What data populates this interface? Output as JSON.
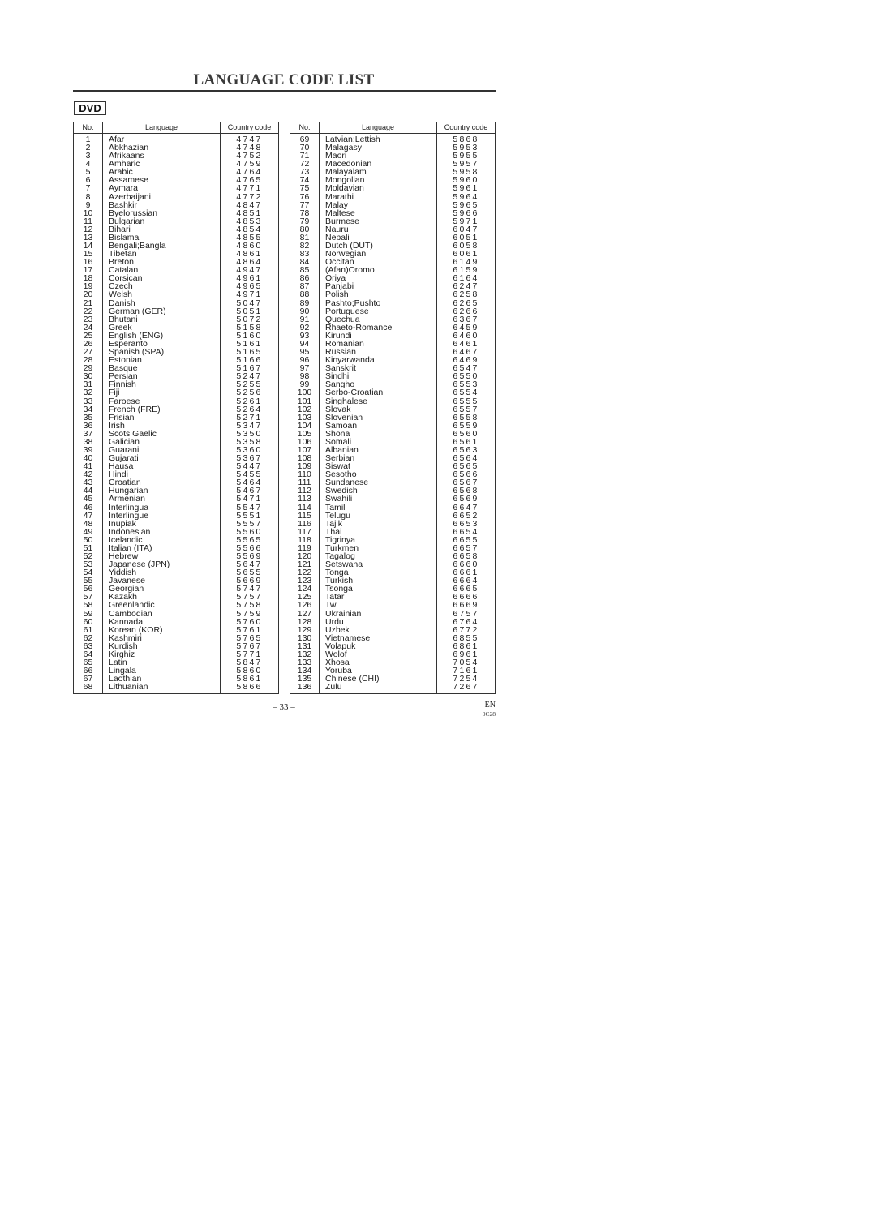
{
  "title": "LANGUAGE CODE LIST",
  "badge": "DVD",
  "columns": {
    "no": "No.",
    "language": "Language",
    "code": "Country code"
  },
  "tables": [
    {
      "rows": [
        [
          "1",
          "Afar",
          "4747"
        ],
        [
          "2",
          "Abkhazian",
          "4748"
        ],
        [
          "3",
          "Afrikaans",
          "4752"
        ],
        [
          "4",
          "Amharic",
          "4759"
        ],
        [
          "5",
          "Arabic",
          "4764"
        ],
        [
          "6",
          "Assamese",
          "4765"
        ],
        [
          "7",
          "Aymara",
          "4771"
        ],
        [
          "8",
          "Azerbaijani",
          "4772"
        ],
        [
          "9",
          "Bashkir",
          "4847"
        ],
        [
          "10",
          "Byelorussian",
          "4851"
        ],
        [
          "11",
          "Bulgarian",
          "4853"
        ],
        [
          "12",
          "Bihari",
          "4854"
        ],
        [
          "13",
          "Bislama",
          "4855"
        ],
        [
          "14",
          "Bengali;Bangla",
          "4860"
        ],
        [
          "15",
          "Tibetan",
          "4861"
        ],
        [
          "16",
          "Breton",
          "4864"
        ],
        [
          "17",
          "Catalan",
          "4947"
        ],
        [
          "18",
          "Corsican",
          "4961"
        ],
        [
          "19",
          "Czech",
          "4965"
        ],
        [
          "20",
          "Welsh",
          "4971"
        ],
        [
          "21",
          "Danish",
          "5047"
        ],
        [
          "22",
          "German (GER)",
          "5051"
        ],
        [
          "23",
          "Bhutani",
          "5072"
        ],
        [
          "24",
          "Greek",
          "5158"
        ],
        [
          "25",
          "English (ENG)",
          "5160"
        ],
        [
          "26",
          "Esperanto",
          "5161"
        ],
        [
          "27",
          "Spanish (SPA)",
          "5165"
        ],
        [
          "28",
          "Estonian",
          "5166"
        ],
        [
          "29",
          "Basque",
          "5167"
        ],
        [
          "30",
          "Persian",
          "5247"
        ],
        [
          "31",
          "Finnish",
          "5255"
        ],
        [
          "32",
          "Fiji",
          "5256"
        ],
        [
          "33",
          "Faroese",
          "5261"
        ],
        [
          "34",
          "French (FRE)",
          "5264"
        ],
        [
          "35",
          "Frisian",
          "5271"
        ],
        [
          "36",
          "Irish",
          "5347"
        ],
        [
          "37",
          "Scots Gaelic",
          "5350"
        ],
        [
          "38",
          "Galician",
          "5358"
        ],
        [
          "39",
          "Guarani",
          "5360"
        ],
        [
          "40",
          "Gujarati",
          "5367"
        ],
        [
          "41",
          "Hausa",
          "5447"
        ],
        [
          "42",
          "Hindi",
          "5455"
        ],
        [
          "43",
          "Croatian",
          "5464"
        ],
        [
          "44",
          "Hungarian",
          "5467"
        ],
        [
          "45",
          "Armenian",
          "5471"
        ],
        [
          "46",
          "Interlingua",
          "5547"
        ],
        [
          "47",
          "Interlingue",
          "5551"
        ],
        [
          "48",
          "Inupiak",
          "5557"
        ],
        [
          "49",
          "Indonesian",
          "5560"
        ],
        [
          "50",
          "Icelandic",
          "5565"
        ],
        [
          "51",
          "Italian (ITA)",
          "5566"
        ],
        [
          "52",
          "Hebrew",
          "5569"
        ],
        [
          "53",
          "Japanese (JPN)",
          "5647"
        ],
        [
          "54",
          "Yiddish",
          "5655"
        ],
        [
          "55",
          "Javanese",
          "5669"
        ],
        [
          "56",
          "Georgian",
          "5747"
        ],
        [
          "57",
          "Kazakh",
          "5757"
        ],
        [
          "58",
          "Greenlandic",
          "5758"
        ],
        [
          "59",
          "Cambodian",
          "5759"
        ],
        [
          "60",
          "Kannada",
          "5760"
        ],
        [
          "61",
          "Korean (KOR)",
          "5761"
        ],
        [
          "62",
          "Kashmiri",
          "5765"
        ],
        [
          "63",
          "Kurdish",
          "5767"
        ],
        [
          "64",
          "Kirghiz",
          "5771"
        ],
        [
          "65",
          "Latin",
          "5847"
        ],
        [
          "66",
          "Lingala",
          "5860"
        ],
        [
          "67",
          "Laothian",
          "5861"
        ],
        [
          "68",
          "Lithuanian",
          "5866"
        ]
      ]
    },
    {
      "rows": [
        [
          "69",
          "Latvian;Lettish",
          "5868"
        ],
        [
          "70",
          "Malagasy",
          "5953"
        ],
        [
          "71",
          "Maori",
          "5955"
        ],
        [
          "72",
          "Macedonian",
          "5957"
        ],
        [
          "73",
          "Malayalam",
          "5958"
        ],
        [
          "74",
          "Mongolian",
          "5960"
        ],
        [
          "75",
          "Moldavian",
          "5961"
        ],
        [
          "76",
          "Marathi",
          "5964"
        ],
        [
          "77",
          "Malay",
          "5965"
        ],
        [
          "78",
          "Maltese",
          "5966"
        ],
        [
          "79",
          "Burmese",
          "5971"
        ],
        [
          "80",
          "Nauru",
          "6047"
        ],
        [
          "81",
          "Nepali",
          "6051"
        ],
        [
          "82",
          "Dutch (DUT)",
          "6058"
        ],
        [
          "83",
          "Norwegian",
          "6061"
        ],
        [
          "84",
          "Occitan",
          "6149"
        ],
        [
          "85",
          "(Afan)Oromo",
          "6159"
        ],
        [
          "86",
          "Oriya",
          "6164"
        ],
        [
          "87",
          "Panjabi",
          "6247"
        ],
        [
          "88",
          "Polish",
          "6258"
        ],
        [
          "89",
          "Pashto;Pushto",
          "6265"
        ],
        [
          "90",
          "Portuguese",
          "6266"
        ],
        [
          "91",
          "Quechua",
          "6367"
        ],
        [
          "92",
          "Rhaeto-Romance",
          "6459"
        ],
        [
          "93",
          "Kirundi",
          "6460"
        ],
        [
          "94",
          "Romanian",
          "6461"
        ],
        [
          "95",
          "Russian",
          "6467"
        ],
        [
          "96",
          "Kinyarwanda",
          "6469"
        ],
        [
          "97",
          "Sanskrit",
          "6547"
        ],
        [
          "98",
          "Sindhi",
          "6550"
        ],
        [
          "99",
          "Sangho",
          "6553"
        ],
        [
          "100",
          "Serbo-Croatian",
          "6554"
        ],
        [
          "101",
          "Singhalese",
          "6555"
        ],
        [
          "102",
          "Slovak",
          "6557"
        ],
        [
          "103",
          "Slovenian",
          "6558"
        ],
        [
          "104",
          "Samoan",
          "6559"
        ],
        [
          "105",
          "Shona",
          "6560"
        ],
        [
          "106",
          "Somali",
          "6561"
        ],
        [
          "107",
          "Albanian",
          "6563"
        ],
        [
          "108",
          "Serbian",
          "6564"
        ],
        [
          "109",
          "Siswat",
          "6565"
        ],
        [
          "110",
          "Sesotho",
          "6566"
        ],
        [
          "111",
          "Sundanese",
          "6567"
        ],
        [
          "112",
          "Swedish",
          "6568"
        ],
        [
          "113",
          "Swahili",
          "6569"
        ],
        [
          "114",
          "Tamil",
          "6647"
        ],
        [
          "115",
          "Telugu",
          "6652"
        ],
        [
          "116",
          "Tajik",
          "6653"
        ],
        [
          "117",
          "Thai",
          "6654"
        ],
        [
          "118",
          "Tigrinya",
          "6655"
        ],
        [
          "119",
          "Turkmen",
          "6657"
        ],
        [
          "120",
          "Tagalog",
          "6658"
        ],
        [
          "121",
          "Setswana",
          "6660"
        ],
        [
          "122",
          "Tonga",
          "6661"
        ],
        [
          "123",
          "Turkish",
          "6664"
        ],
        [
          "124",
          "Tsonga",
          "6665"
        ],
        [
          "125",
          "Tatar",
          "6666"
        ],
        [
          "126",
          "Twi",
          "6669"
        ],
        [
          "127",
          "Ukrainian",
          "6757"
        ],
        [
          "128",
          "Urdu",
          "6764"
        ],
        [
          "129",
          "Uzbek",
          "6772"
        ],
        [
          "130",
          "Vietnamese",
          "6855"
        ],
        [
          "131",
          "Volapuk",
          "6861"
        ],
        [
          "132",
          "Wolof",
          "6961"
        ],
        [
          "133",
          "Xhosa",
          "7054"
        ],
        [
          "134",
          "Yoruba",
          "7161"
        ],
        [
          "135",
          "Chinese (CHI)",
          "7254"
        ],
        [
          "136",
          "Zulu",
          "7267"
        ]
      ]
    }
  ],
  "footer": {
    "page_number": "– 33 –",
    "language": "EN",
    "doc_code": "0C28"
  }
}
